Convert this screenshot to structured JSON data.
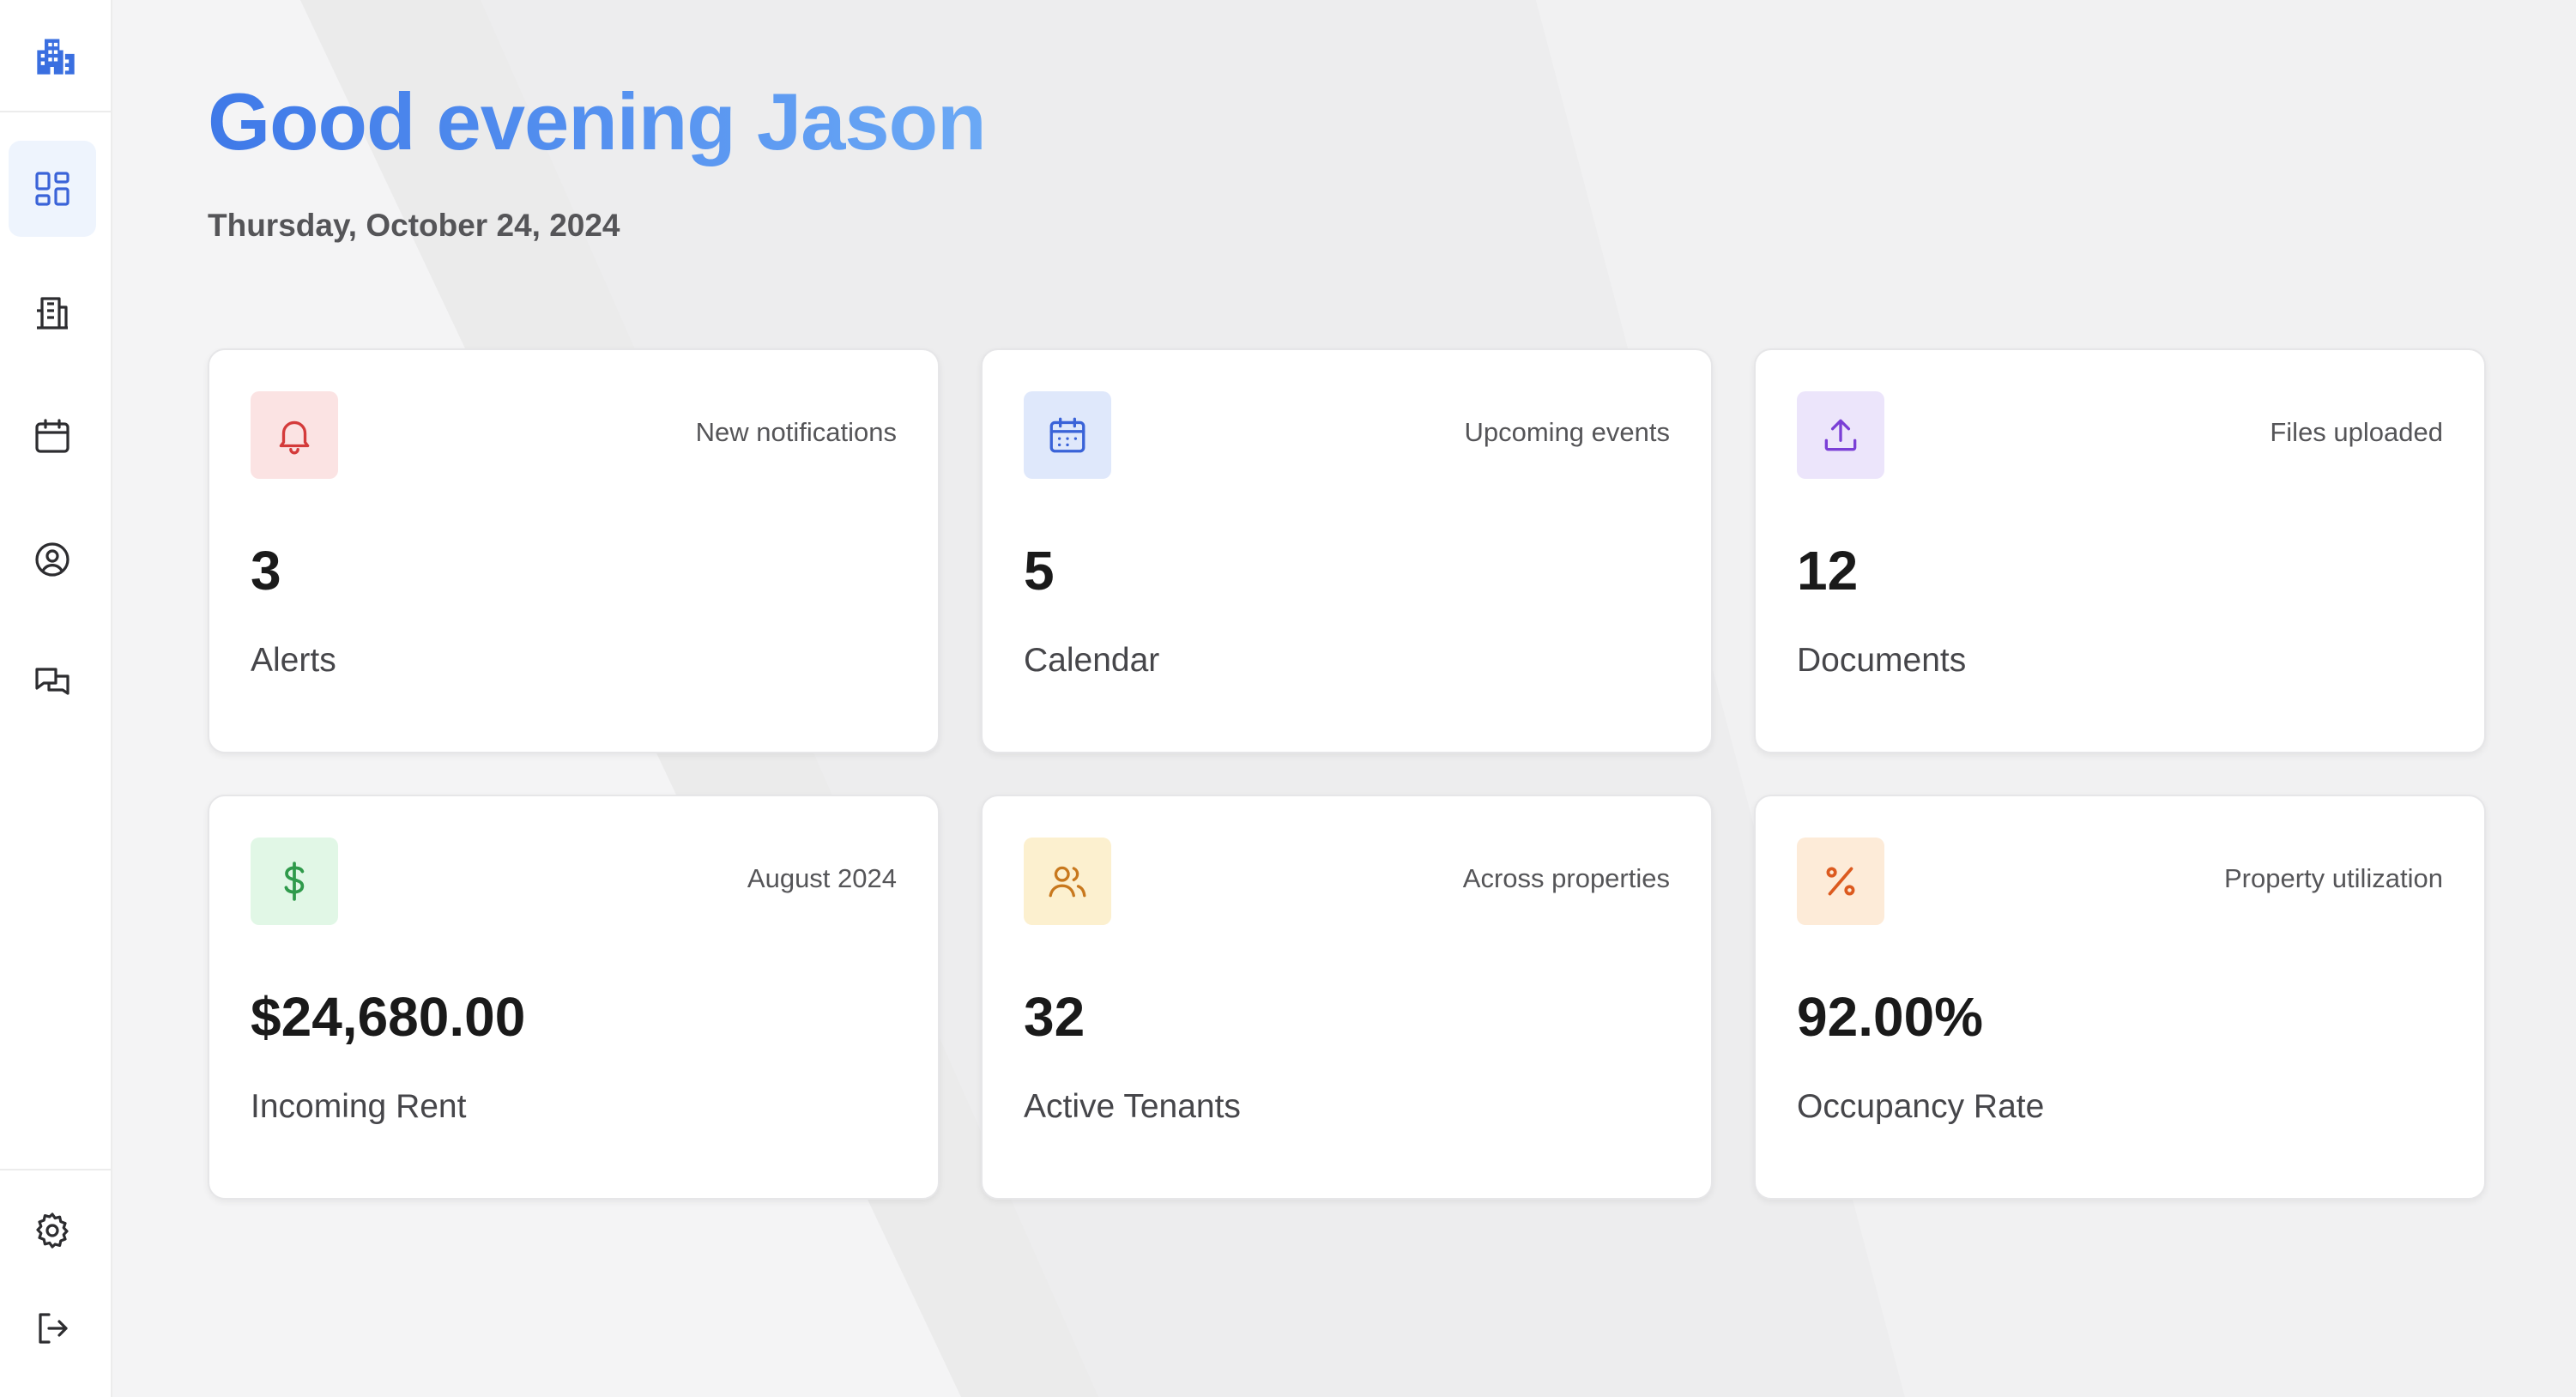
{
  "header": {
    "greeting": "Good evening Jason",
    "date": "Thursday, October 24, 2024"
  },
  "sidebar": {
    "logo_icon": "building-icon",
    "items": [
      {
        "icon": "dashboard-icon",
        "active": true
      },
      {
        "icon": "buildings-icon",
        "active": false
      },
      {
        "icon": "calendar-icon",
        "active": false
      },
      {
        "icon": "user-circle-icon",
        "active": false
      },
      {
        "icon": "messages-icon",
        "active": false
      }
    ],
    "bottom_items": [
      {
        "icon": "gear-icon"
      },
      {
        "icon": "logout-icon"
      }
    ]
  },
  "cards": [
    {
      "icon": "bell-icon",
      "caption": "New notifications",
      "value": "3",
      "label": "Alerts",
      "icon_bg": "#fbe3e3",
      "icon_color": "#d43b3b"
    },
    {
      "icon": "calendar-icon",
      "caption": "Upcoming events",
      "value": "5",
      "label": "Calendar",
      "icon_bg": "#dfe8fb",
      "icon_color": "#3a63d8"
    },
    {
      "icon": "upload-icon",
      "caption": "Files uploaded",
      "value": "12",
      "label": "Documents",
      "icon_bg": "#ece5fb",
      "icon_color": "#7a3fd6"
    },
    {
      "icon": "dollar-icon",
      "caption": "August 2024",
      "value": "$24,680.00",
      "label": "Incoming Rent",
      "icon_bg": "#e1f7e6",
      "icon_color": "#2f9a4b"
    },
    {
      "icon": "users-icon",
      "caption": "Across properties",
      "value": "32",
      "label": "Active Tenants",
      "icon_bg": "#fcf0cf",
      "icon_color": "#c8781d"
    },
    {
      "icon": "percent-icon",
      "caption": "Property utilization",
      "value": "92.00%",
      "label": "Occupancy Rate",
      "icon_bg": "#fdebd8",
      "icon_color": "#dc5a1f"
    }
  ],
  "colors": {
    "accent": "#3f79e8",
    "sidebar_active_bg": "#eef4fd",
    "background": "#f3f3f4"
  }
}
